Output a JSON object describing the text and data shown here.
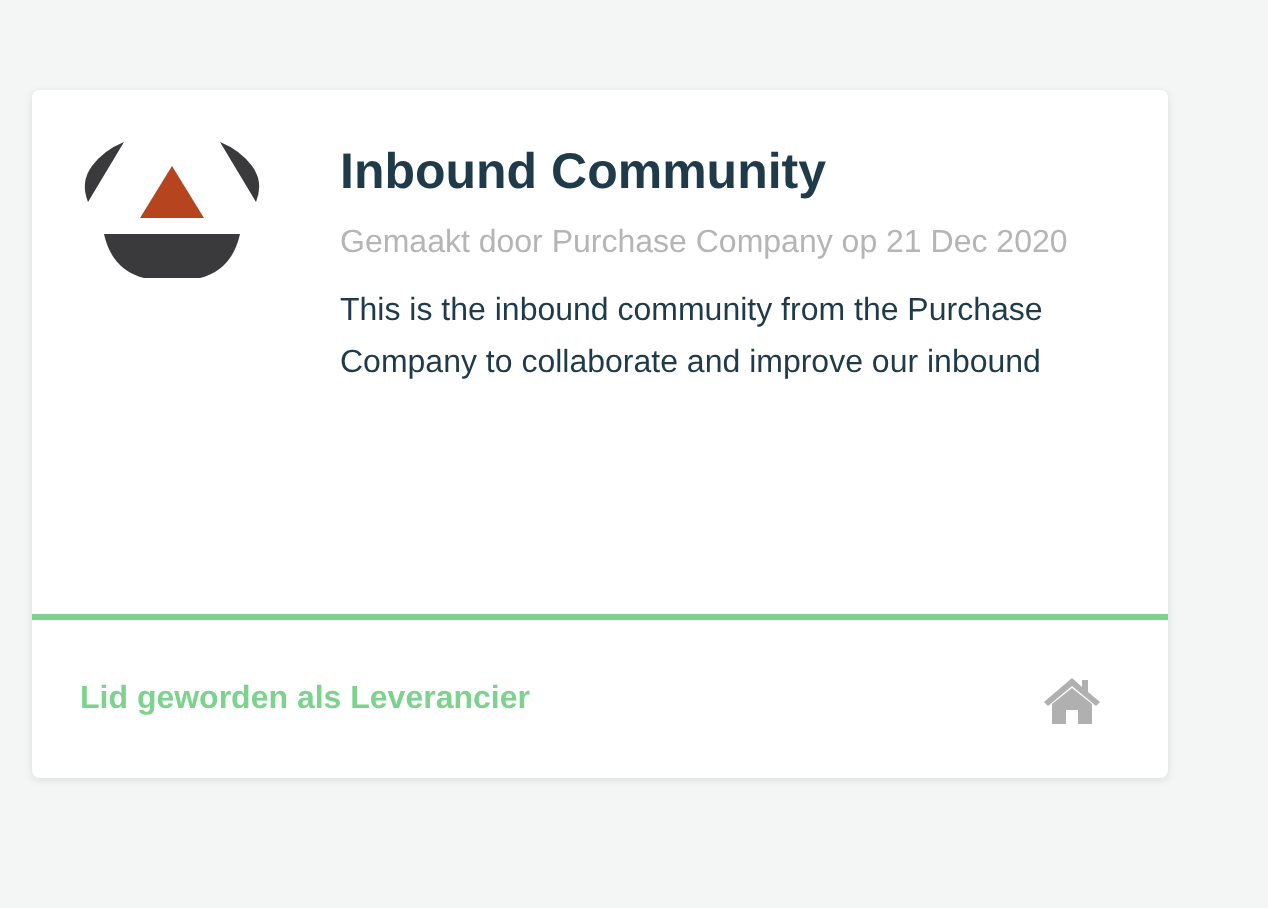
{
  "card": {
    "title": "Inbound Community",
    "meta": "Gemaakt door Purchase Company op 21 Dec 2020",
    "description": "This is the inbound community from the Purchase Company to collaborate and improve our inbound",
    "footer": {
      "link": "Lid geworden als Leverancier"
    }
  }
}
